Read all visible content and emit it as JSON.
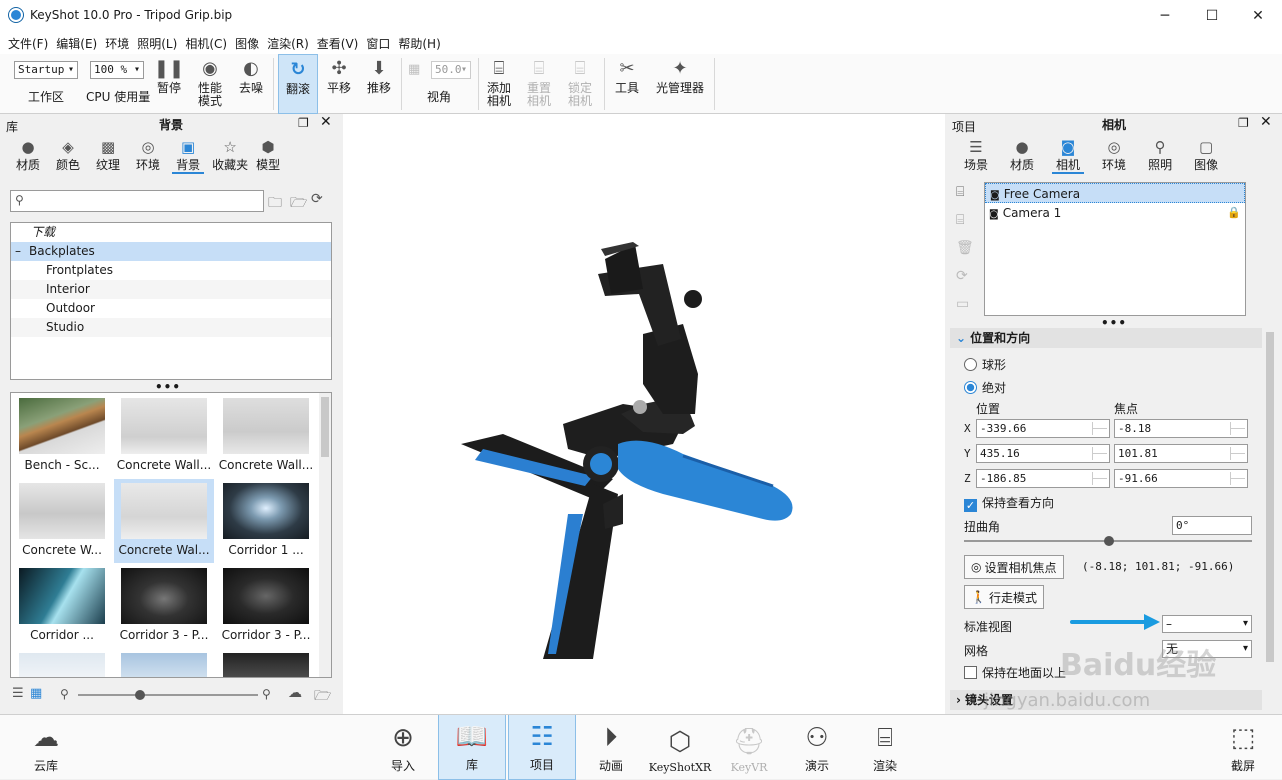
{
  "window": {
    "title": "KeyShot 10.0 Pro  - Tripod Grip.bip",
    "min": "─",
    "max": "☐",
    "close": "✕"
  },
  "menu": [
    "文件(F)",
    "编辑(E)",
    "环境",
    "照明(L)",
    "相机(C)",
    "图像",
    "渲染(R)",
    "查看(V)",
    "窗口",
    "帮助(H)"
  ],
  "toolbar": {
    "workspace_value": "Startup",
    "workspace_label": "工作区",
    "cpu_value": "100 %",
    "cpu_label": "CPU 使用量",
    "pause": "暂停",
    "perf1": "性能",
    "perf2": "模式",
    "denoise": "去噪",
    "tumble": "翻滚",
    "pan": "平移",
    "dolly": "推移",
    "fov_value": "50.0",
    "view": "视角",
    "add_cam1": "添加",
    "add_cam2": "相机",
    "reset_cam1": "重置",
    "reset_cam2": "相机",
    "lock_cam1": "锁定",
    "lock_cam2": "相机",
    "tools": "工具",
    "light_mgr": "光管理器"
  },
  "library": {
    "side_label": "库",
    "title": "背景",
    "tabs": [
      "材质",
      "颜色",
      "纹理",
      "环境",
      "背景",
      "收藏夹",
      "模型"
    ],
    "tree": {
      "download": "下载",
      "backplates": "Backplates",
      "children": [
        "Frontplates",
        "Interior",
        "Outdoor",
        "Studio"
      ]
    },
    "thumbs": [
      "Bench - Sc...",
      "Concrete Wall...",
      "Concrete Wall...",
      "Concrete W...",
      "Concrete Wal...",
      "Corridor 1 ...",
      "Corridor ...",
      "Corridor 3 - P...",
      "Corridor 3 - P..."
    ]
  },
  "project": {
    "side_label": "项目",
    "title": "相机",
    "tabs": [
      "场景",
      "材质",
      "相机",
      "环境",
      "照明",
      "图像"
    ],
    "cameras": [
      "Free Camera",
      "Camera 1"
    ],
    "section_pos": "位置和方向",
    "spherical": "球形",
    "absolute": "绝对",
    "pos_label": "位置",
    "focus_label": "焦点",
    "x": "X",
    "y": "Y",
    "z": "Z",
    "pos": {
      "x": "-339.66",
      "y": "435.16",
      "z": "-186.85"
    },
    "focus": {
      "x": "-8.18",
      "y": "101.81",
      "z": "-91.66"
    },
    "keep_look": "保持查看方向",
    "twist_label": "扭曲角",
    "twist_value": "0°",
    "set_focus": "设置相机焦点",
    "focus_readout": "(-8.18; 101.81; -91.66)",
    "walk": "行走模式",
    "std_view": "标准视图",
    "std_view_value": "–",
    "grid": "网格",
    "grid_value": "无",
    "keep_ground": "保持在地面以上",
    "lens": "镜头设置"
  },
  "bottom": {
    "cloud": "云库",
    "import": "导入",
    "library": "库",
    "project": "项目",
    "animation": "动画",
    "keyshotxr": "KeyShotXR",
    "keyvr": "KeyVR",
    "present": "演示",
    "render": "渲染",
    "screenshot": "截屏"
  },
  "watermark": "Baidu经验",
  "watermark_url": "jingyan.baidu.com",
  "colors": {
    "accent": "#2b86d6",
    "arrow": "#1a9be0"
  }
}
